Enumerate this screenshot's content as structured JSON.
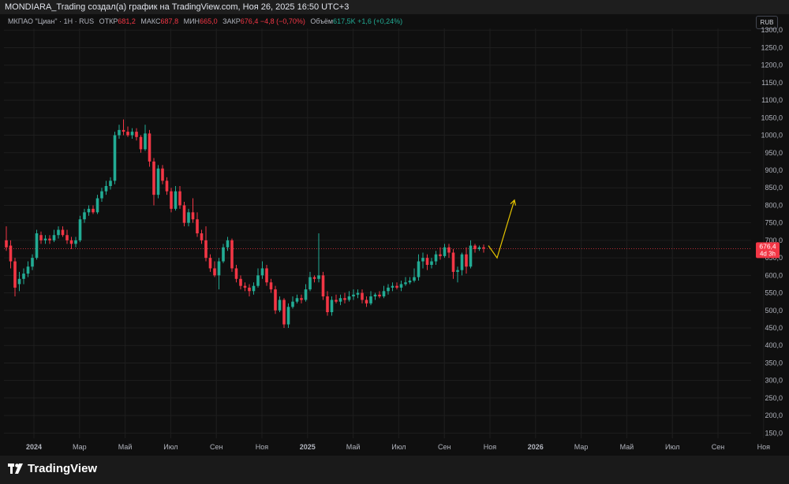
{
  "header": {
    "title": "MONDIARA_Trading создал(а) график на TradingView.com, Ноя 26, 2025 16:50 UTC+3"
  },
  "legend": {
    "symbol": "МКПАО \"Циан\" · 1Н · RUS",
    "open_label": "ОТКР",
    "open_value": "681,2",
    "high_label": "МАКС",
    "high_value": "687,8",
    "low_label": "МИН",
    "low_value": "665,0",
    "close_label": "ЗАКР",
    "close_value": "676,4",
    "change": "−4,8 (−0,70%)",
    "volume_label": "Объём",
    "volume_value": "617,5K",
    "volume_change": "+1,6 (+0,24%)"
  },
  "currency": "RUB",
  "price_tag": {
    "value": "676,4",
    "countdown": "4d 3h"
  },
  "brand": {
    "name": "TradingView"
  },
  "colors": {
    "up": "#22ab94",
    "down": "#f23645",
    "arrow": "#e5c400",
    "background": "#0f0f0f",
    "grid": "#1e1e1e"
  },
  "chart_data": {
    "type": "candlestick",
    "x_labels": [
      "2024",
      "Мар",
      "Май",
      "Июл",
      "Сен",
      "Ноя",
      "2025",
      "Май",
      "Июл",
      "Сен",
      "Ноя",
      "2026",
      "Мар",
      "Май",
      "Июл",
      "Сен",
      "Ноя"
    ],
    "y_ticks": [
      "150,0",
      "200,0",
      "250,0",
      "300,0",
      "350,0",
      "400,0",
      "450,0",
      "500,0",
      "550,0",
      "600,0",
      "650,0",
      "700,0",
      "750,0",
      "800,0",
      "850,0",
      "900,0",
      "950,0",
      "1000,0",
      "1050,0",
      "1100,0",
      "1150,0",
      "1200,0",
      "1250,0",
      "1300,0"
    ],
    "y_tick_values": [
      150,
      200,
      250,
      300,
      350,
      400,
      450,
      500,
      550,
      600,
      650,
      700,
      750,
      800,
      850,
      900,
      950,
      1000,
      1050,
      1100,
      1150,
      1200,
      1250,
      1300
    ],
    "ylim": [
      135,
      1305
    ],
    "last_price": 676.4,
    "candles": [
      [
        700,
        680,
        740,
        670
      ],
      [
        685,
        640,
        700,
        620
      ],
      [
        640,
        565,
        650,
        540
      ],
      [
        575,
        590,
        610,
        555
      ],
      [
        590,
        605,
        620,
        575
      ],
      [
        605,
        625,
        640,
        595
      ],
      [
        625,
        650,
        660,
        615
      ],
      [
        650,
        720,
        730,
        645
      ],
      [
        715,
        700,
        725,
        690
      ],
      [
        700,
        705,
        715,
        690
      ],
      [
        705,
        700,
        715,
        690
      ],
      [
        700,
        715,
        730,
        695
      ],
      [
        715,
        730,
        740,
        705
      ],
      [
        730,
        715,
        740,
        710
      ],
      [
        715,
        700,
        730,
        690
      ],
      [
        700,
        690,
        710,
        675
      ],
      [
        690,
        700,
        710,
        680
      ],
      [
        700,
        760,
        770,
        695
      ],
      [
        760,
        780,
        790,
        750
      ],
      [
        780,
        790,
        800,
        770
      ],
      [
        790,
        780,
        800,
        775
      ],
      [
        780,
        820,
        830,
        775
      ],
      [
        820,
        840,
        850,
        810
      ],
      [
        840,
        855,
        870,
        830
      ],
      [
        855,
        870,
        880,
        845
      ],
      [
        870,
        1000,
        1010,
        860
      ],
      [
        1000,
        1015,
        1030,
        990
      ],
      [
        1015,
        1010,
        1045,
        1000
      ],
      [
        1010,
        1000,
        1025,
        995
      ],
      [
        1000,
        1010,
        1020,
        990
      ],
      [
        1010,
        995,
        1020,
        985
      ],
      [
        995,
        960,
        1000,
        950
      ],
      [
        960,
        1005,
        1030,
        955
      ],
      [
        1005,
        925,
        1015,
        910
      ],
      [
        925,
        830,
        935,
        800
      ],
      [
        830,
        905,
        915,
        820
      ],
      [
        905,
        870,
        915,
        860
      ],
      [
        870,
        840,
        880,
        830
      ],
      [
        840,
        790,
        850,
        780
      ],
      [
        790,
        840,
        855,
        785
      ],
      [
        840,
        800,
        855,
        790
      ],
      [
        800,
        750,
        810,
        740
      ],
      [
        750,
        780,
        790,
        740
      ],
      [
        780,
        760,
        820,
        750
      ],
      [
        760,
        720,
        780,
        710
      ],
      [
        720,
        700,
        730,
        690
      ],
      [
        700,
        650,
        740,
        640
      ],
      [
        650,
        620,
        660,
        610
      ],
      [
        620,
        600,
        640,
        595
      ],
      [
        600,
        640,
        650,
        560
      ],
      [
        640,
        680,
        690,
        635
      ],
      [
        680,
        700,
        710,
        670
      ],
      [
        700,
        620,
        705,
        610
      ],
      [
        620,
        590,
        630,
        580
      ],
      [
        590,
        570,
        600,
        560
      ],
      [
        570,
        565,
        580,
        555
      ],
      [
        565,
        555,
        575,
        540
      ],
      [
        555,
        570,
        580,
        545
      ],
      [
        570,
        600,
        620,
        565
      ],
      [
        600,
        620,
        640,
        590
      ],
      [
        620,
        580,
        630,
        570
      ],
      [
        580,
        560,
        590,
        550
      ],
      [
        560,
        500,
        570,
        490
      ],
      [
        500,
        530,
        540,
        495
      ],
      [
        530,
        460,
        535,
        450
      ],
      [
        460,
        510,
        520,
        450
      ],
      [
        510,
        525,
        540,
        505
      ],
      [
        525,
        535,
        545,
        520
      ],
      [
        535,
        530,
        545,
        520
      ],
      [
        530,
        560,
        575,
        525
      ],
      [
        560,
        595,
        610,
        555
      ],
      [
        595,
        590,
        600,
        580
      ],
      [
        590,
        600,
        720,
        580
      ],
      [
        600,
        540,
        610,
        530
      ],
      [
        540,
        495,
        555,
        485
      ],
      [
        495,
        530,
        540,
        485
      ],
      [
        530,
        525,
        545,
        520
      ],
      [
        525,
        535,
        545,
        515
      ],
      [
        535,
        530,
        550,
        520
      ],
      [
        530,
        540,
        555,
        525
      ],
      [
        540,
        545,
        560,
        530
      ],
      [
        545,
        550,
        560,
        535
      ],
      [
        550,
        530,
        560,
        520
      ],
      [
        530,
        520,
        540,
        510
      ],
      [
        520,
        540,
        555,
        515
      ],
      [
        540,
        545,
        550,
        530
      ],
      [
        545,
        540,
        555,
        535
      ],
      [
        540,
        555,
        570,
        535
      ],
      [
        555,
        565,
        575,
        545
      ],
      [
        565,
        570,
        580,
        555
      ],
      [
        570,
        565,
        580,
        560
      ],
      [
        565,
        575,
        585,
        555
      ],
      [
        575,
        580,
        595,
        570
      ],
      [
        580,
        585,
        595,
        575
      ],
      [
        585,
        595,
        620,
        580
      ],
      [
        595,
        640,
        660,
        585
      ],
      [
        640,
        650,
        665,
        620
      ],
      [
        650,
        630,
        660,
        615
      ],
      [
        630,
        640,
        650,
        620
      ],
      [
        640,
        660,
        670,
        630
      ],
      [
        660,
        655,
        680,
        645
      ],
      [
        655,
        680,
        690,
        650
      ],
      [
        680,
        665,
        690,
        650
      ],
      [
        665,
        610,
        675,
        590
      ],
      [
        610,
        615,
        625,
        580
      ],
      [
        615,
        660,
        665,
        600
      ],
      [
        660,
        625,
        680,
        605
      ],
      [
        625,
        685,
        700,
        620
      ],
      [
        685,
        675,
        690,
        665
      ],
      [
        675,
        680,
        685,
        670
      ],
      [
        680,
        676.4,
        687.8,
        665
      ]
    ],
    "forecast_arrow": [
      [
        0,
        685
      ],
      [
        2,
        650
      ],
      [
        6,
        815
      ]
    ]
  }
}
